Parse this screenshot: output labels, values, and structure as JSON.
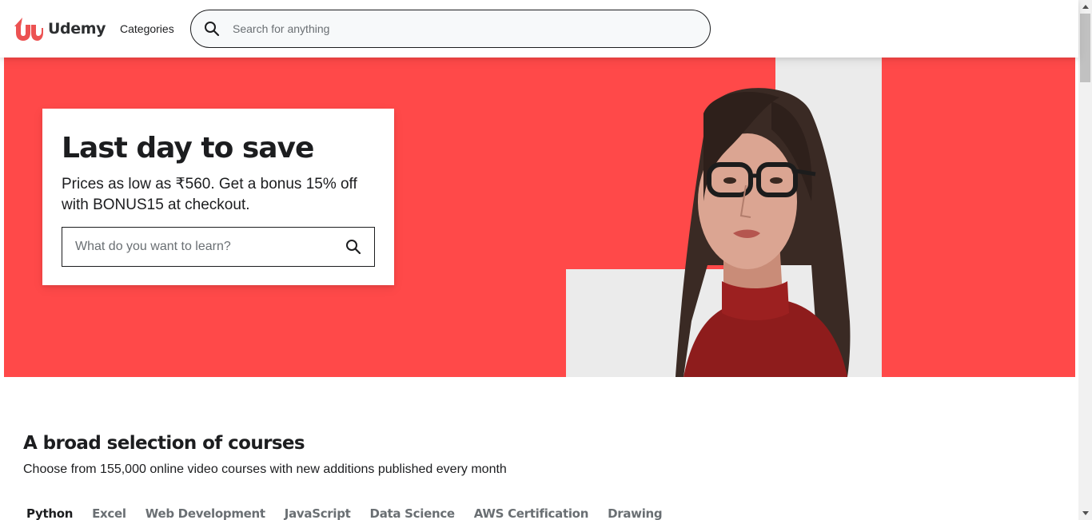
{
  "header": {
    "logo_text": "Udemy",
    "categories_label": "Categories",
    "search_placeholder": "Search for anything"
  },
  "hero": {
    "title": "Last day to save",
    "subtitle": "Prices as low as ₹560. Get a bonus 15% off with BONUS15 at checkout.",
    "search_placeholder": "What do you want to learn?"
  },
  "courses": {
    "title": "A broad selection of courses",
    "subtitle": "Choose from 155,000 online video courses with new additions published every month",
    "tabs": [
      {
        "label": "Python",
        "active": true
      },
      {
        "label": "Excel",
        "active": false
      },
      {
        "label": "Web Development",
        "active": false
      },
      {
        "label": "JavaScript",
        "active": false
      },
      {
        "label": "Data Science",
        "active": false
      },
      {
        "label": "AWS Certification",
        "active": false
      },
      {
        "label": "Drawing",
        "active": false
      }
    ]
  },
  "icons": {
    "logo": "udemy-logo-icon",
    "search": "search-icon"
  },
  "colors": {
    "brand": "#a435f0",
    "logo_red": "#ec5252",
    "hero_bg": "#ff4949",
    "text": "#1c1d1f",
    "muted": "#6a6f73"
  }
}
